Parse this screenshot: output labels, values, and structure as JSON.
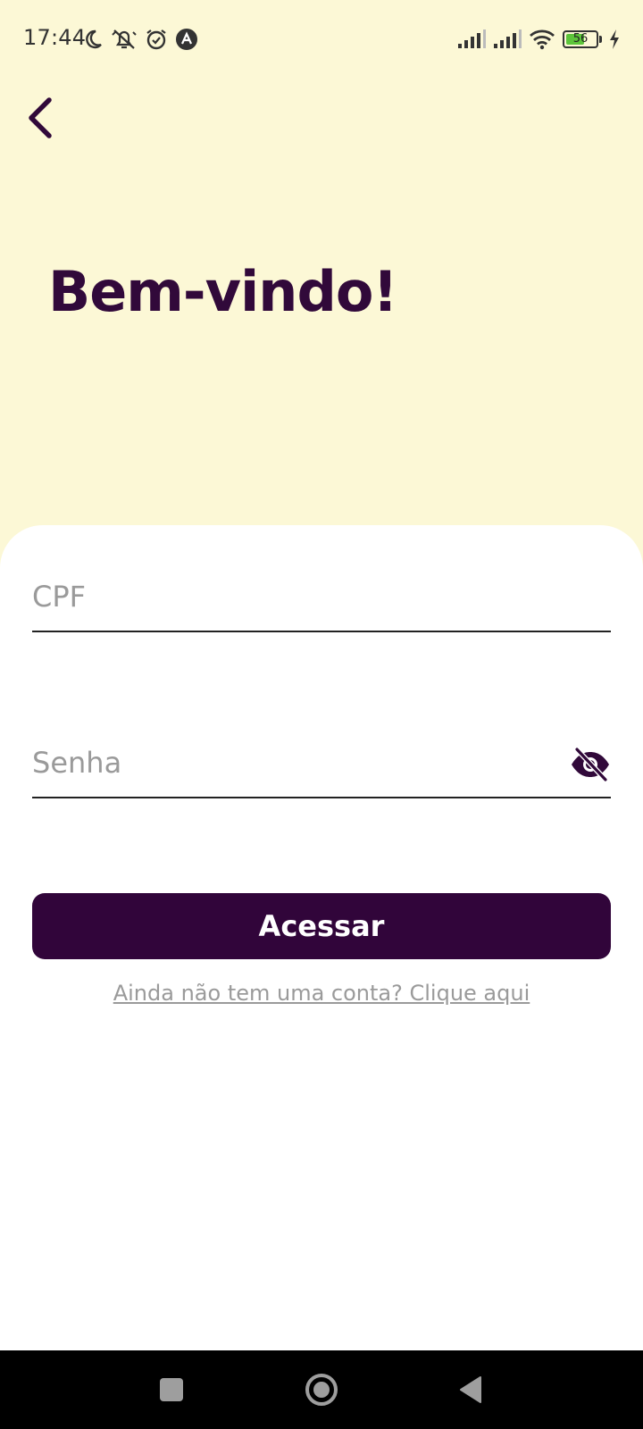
{
  "status_bar": {
    "time": "17:44",
    "left_icons": [
      "moon-icon",
      "notifications-off-icon",
      "alarm-icon",
      "app-icon"
    ],
    "right_icons": [
      "signal-icon",
      "signal-icon",
      "wifi-icon",
      "battery-icon",
      "charging-icon"
    ],
    "battery_level": "56"
  },
  "header": {
    "back_icon": "chevron-left-icon",
    "title": "Bem-vindo!"
  },
  "form": {
    "cpf_placeholder": "CPF",
    "cpf_value": "",
    "password_placeholder": "Senha",
    "password_value": "",
    "password_toggle_icon": "eye-off-icon",
    "submit_label": "Acessar",
    "signup_link": "Ainda não tem uma conta? Clique aqui"
  },
  "nav_bar": {
    "buttons": [
      "recents-square-icon",
      "home-circle-icon",
      "back-triangle-icon"
    ]
  },
  "colors": {
    "background": "#fcf8d6",
    "accent": "#31053a",
    "card": "#ffffff",
    "placeholder": "#9a9a9a"
  }
}
